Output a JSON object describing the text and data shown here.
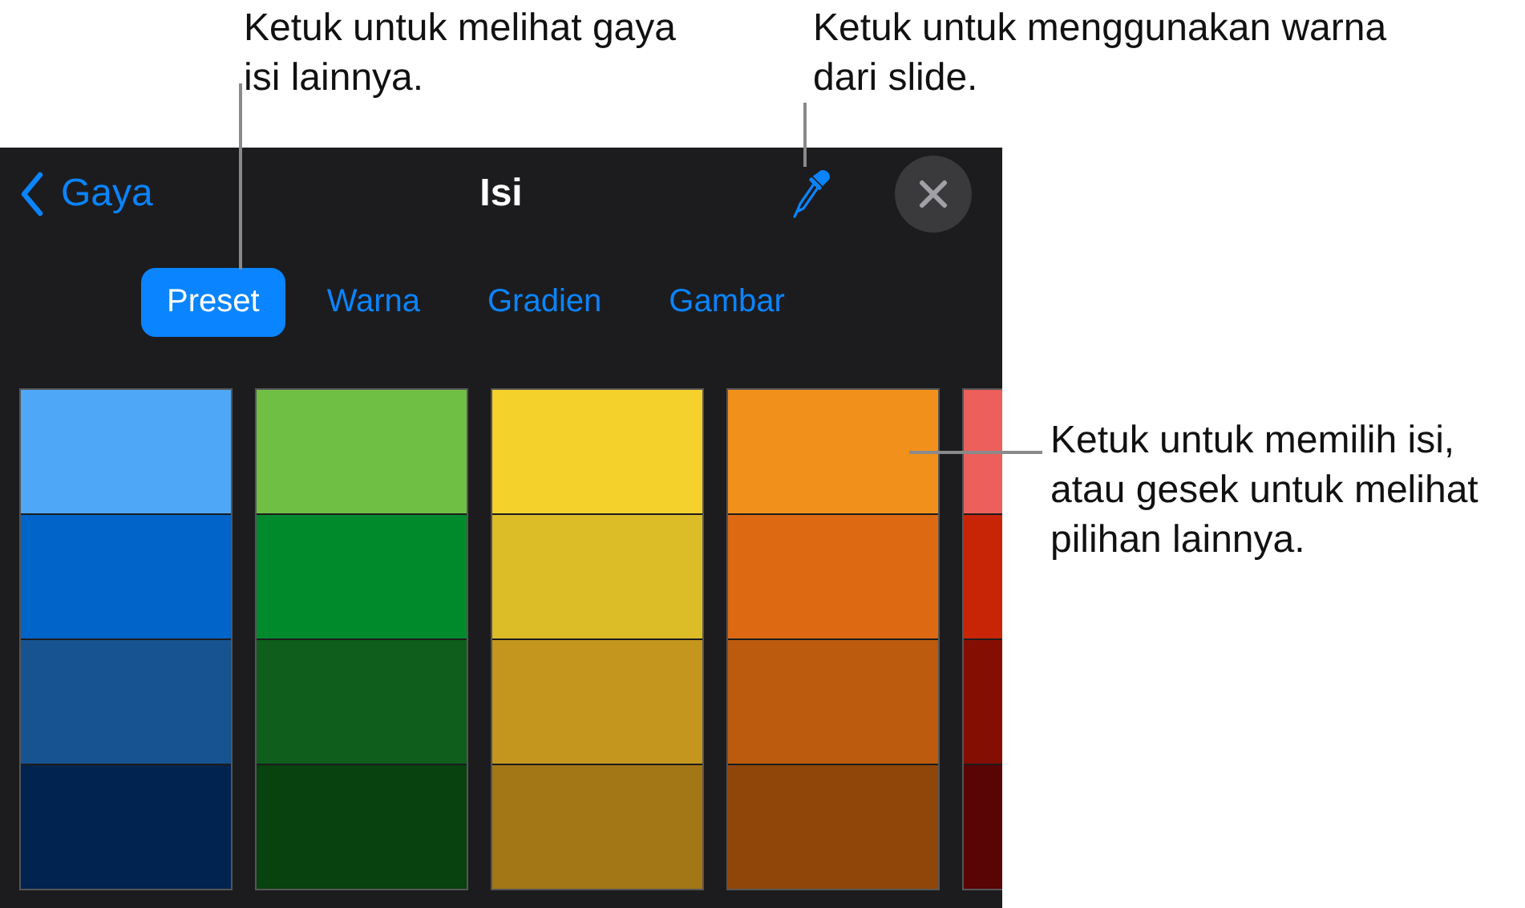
{
  "callouts": [
    {
      "text": "Ketuk untuk melihat gaya isi lainnya."
    },
    {
      "text": "Ketuk untuk menggunakan warna dari slide."
    },
    {
      "text": "Ketuk untuk memilih isi, atau gesek untuk melihat pilihan lainnya."
    }
  ],
  "nav": {
    "back_label": "Gaya",
    "title": "Isi"
  },
  "tabs": [
    {
      "label": "Preset",
      "selected": true
    },
    {
      "label": "Warna",
      "selected": false
    },
    {
      "label": "Gradien",
      "selected": false
    },
    {
      "label": "Gambar",
      "selected": false
    }
  ],
  "palette": [
    {
      "swatches": [
        {
          "color": "#4fa7f8"
        },
        {
          "color": "#0064c8"
        },
        {
          "color": "#175390"
        },
        {
          "color": "#00234f"
        }
      ]
    },
    {
      "swatches": [
        {
          "color": "#70bf45"
        },
        {
          "color": "#008a2c"
        },
        {
          "color": "#0f5e1c"
        },
        {
          "color": "#07420f"
        }
      ]
    },
    {
      "swatches": [
        {
          "color": "#f4d12b"
        },
        {
          "color": "#dcbc27"
        },
        {
          "color": "#c4961e"
        },
        {
          "color": "#a37716"
        }
      ]
    },
    {
      "swatches": [
        {
          "color": "#f2901c"
        },
        {
          "color": "#dd6912"
        },
        {
          "color": "#bc5b0d"
        },
        {
          "color": "#8f4608"
        }
      ]
    },
    {
      "swatches": [
        {
          "color": "#ec5f5a"
        },
        {
          "color": "#c72506"
        },
        {
          "color": "#850e02"
        },
        {
          "color": "#590405"
        }
      ]
    }
  ]
}
